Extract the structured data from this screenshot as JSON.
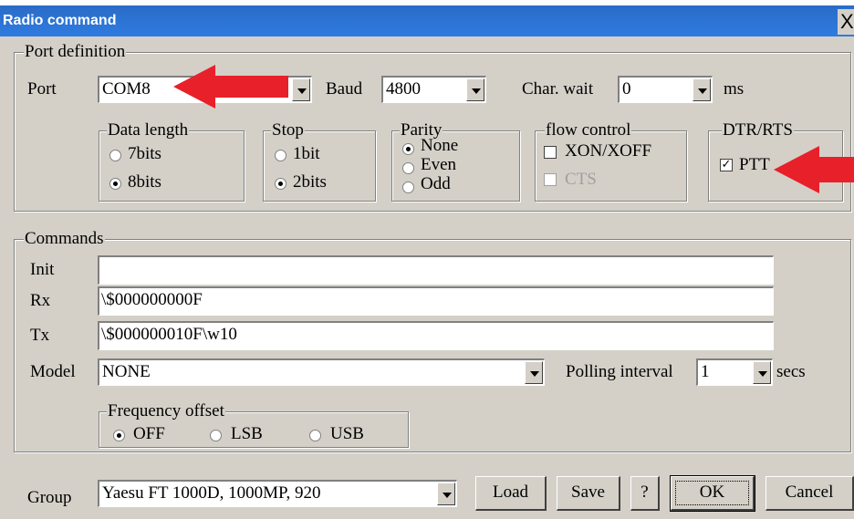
{
  "window": {
    "title": "Radio command",
    "close_glyph": "X"
  },
  "port_definition": {
    "legend": "Port definition",
    "port": {
      "label": "Port",
      "value": "COM8"
    },
    "baud": {
      "label": "Baud",
      "value": "4800"
    },
    "char_wait": {
      "label": "Char. wait",
      "value": "0",
      "unit": "ms"
    },
    "data_length": {
      "legend": "Data length",
      "options": [
        "7bits",
        "8bits"
      ],
      "selected": "8bits"
    },
    "stop": {
      "legend": "Stop",
      "options": [
        "1bit",
        "2bits"
      ],
      "selected": "2bits"
    },
    "parity": {
      "legend": "Parity",
      "options": [
        "None",
        "Even",
        "Odd"
      ],
      "selected": "None"
    },
    "flow_control": {
      "legend": "flow control",
      "xon_xoff": {
        "label": "XON/XOFF",
        "checked": false
      },
      "cts": {
        "label": "CTS",
        "checked": false,
        "disabled": true
      }
    },
    "dtr_rts": {
      "legend": "DTR/RTS",
      "ptt": {
        "label": "PTT",
        "checked": true,
        "mark": "✓"
      }
    }
  },
  "commands": {
    "legend": "Commands",
    "init": {
      "label": "Init",
      "value": ""
    },
    "rx": {
      "label": "Rx",
      "value": "\\$000000000F"
    },
    "tx": {
      "label": "Tx",
      "value": "\\$000000010F\\w10"
    },
    "model": {
      "label": "Model",
      "value": "NONE"
    },
    "polling": {
      "label": "Polling interval",
      "value": "1",
      "unit": "secs"
    },
    "frequency_offset": {
      "legend": "Frequency offset",
      "options": [
        "OFF",
        "LSB",
        "USB"
      ],
      "selected": "OFF"
    }
  },
  "footer": {
    "group": {
      "label": "Group",
      "value": "Yaesu FT 1000D, 1000MP, 920"
    },
    "buttons": {
      "load": "Load",
      "save": "Save",
      "help": "?",
      "ok": "OK",
      "cancel": "Cancel"
    }
  },
  "annotations": {
    "arrow_color": "#e8202a"
  }
}
